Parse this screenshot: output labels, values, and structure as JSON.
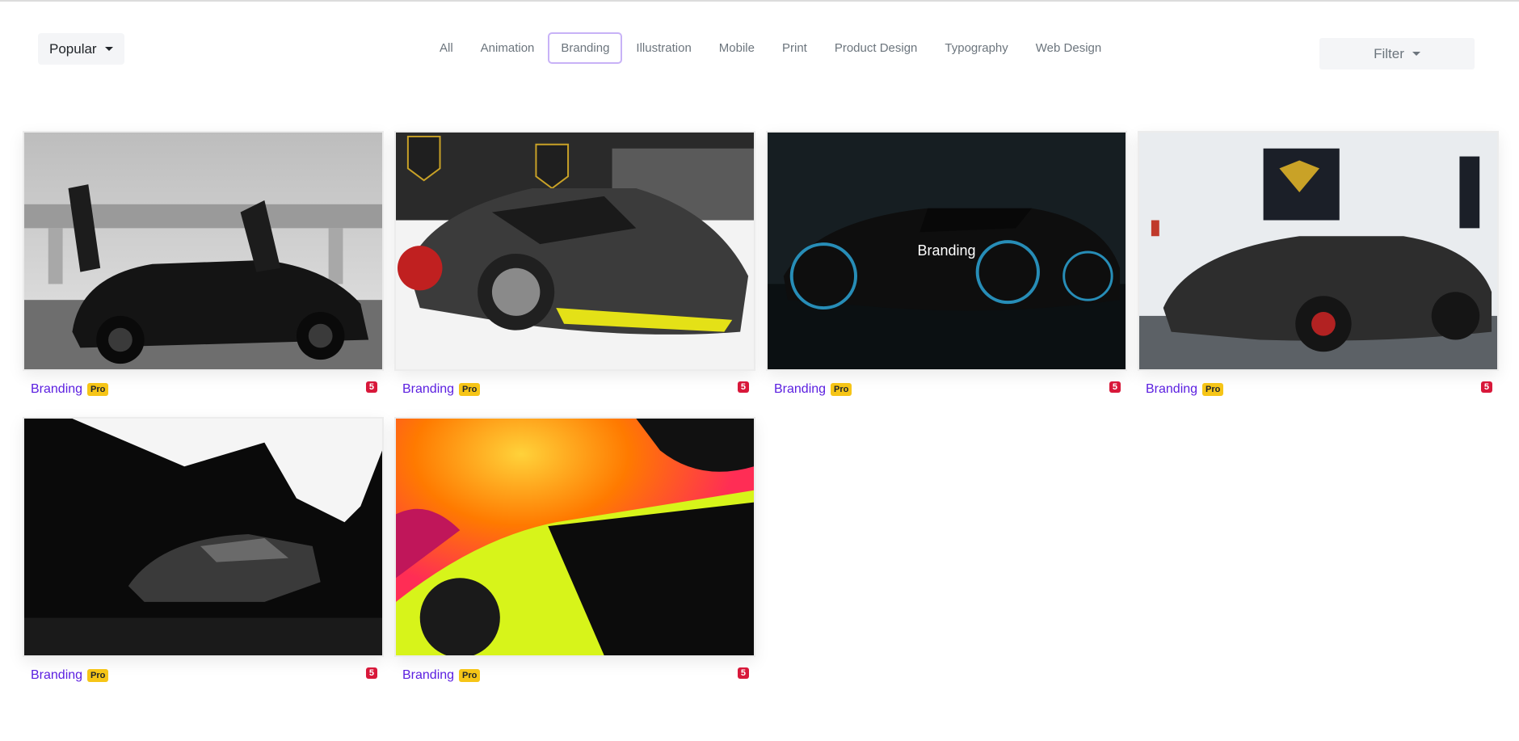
{
  "sort": {
    "label": "Popular"
  },
  "categories": [
    "All",
    "Animation",
    "Branding",
    "Illustration",
    "Mobile",
    "Print",
    "Product Design",
    "Typography",
    "Web Design"
  ],
  "active_category": "Branding",
  "filter": {
    "label": "Filter"
  },
  "hover_overlay_label": "Branding",
  "cards": [
    {
      "title": "Branding",
      "badge": "Pro",
      "count": "5"
    },
    {
      "title": "Branding",
      "badge": "Pro",
      "count": "5"
    },
    {
      "title": "Branding",
      "badge": "Pro",
      "count": "5"
    },
    {
      "title": "Branding",
      "badge": "Pro",
      "count": "5"
    },
    {
      "title": "Branding",
      "badge": "Pro",
      "count": "5"
    },
    {
      "title": "Branding",
      "badge": "Pro",
      "count": "5"
    }
  ],
  "colors": {
    "accent": "#5b1fe0",
    "pro_badge": "#f6c517",
    "count_badge": "#d8183a",
    "active_tab_border": "#c8b2f7"
  }
}
